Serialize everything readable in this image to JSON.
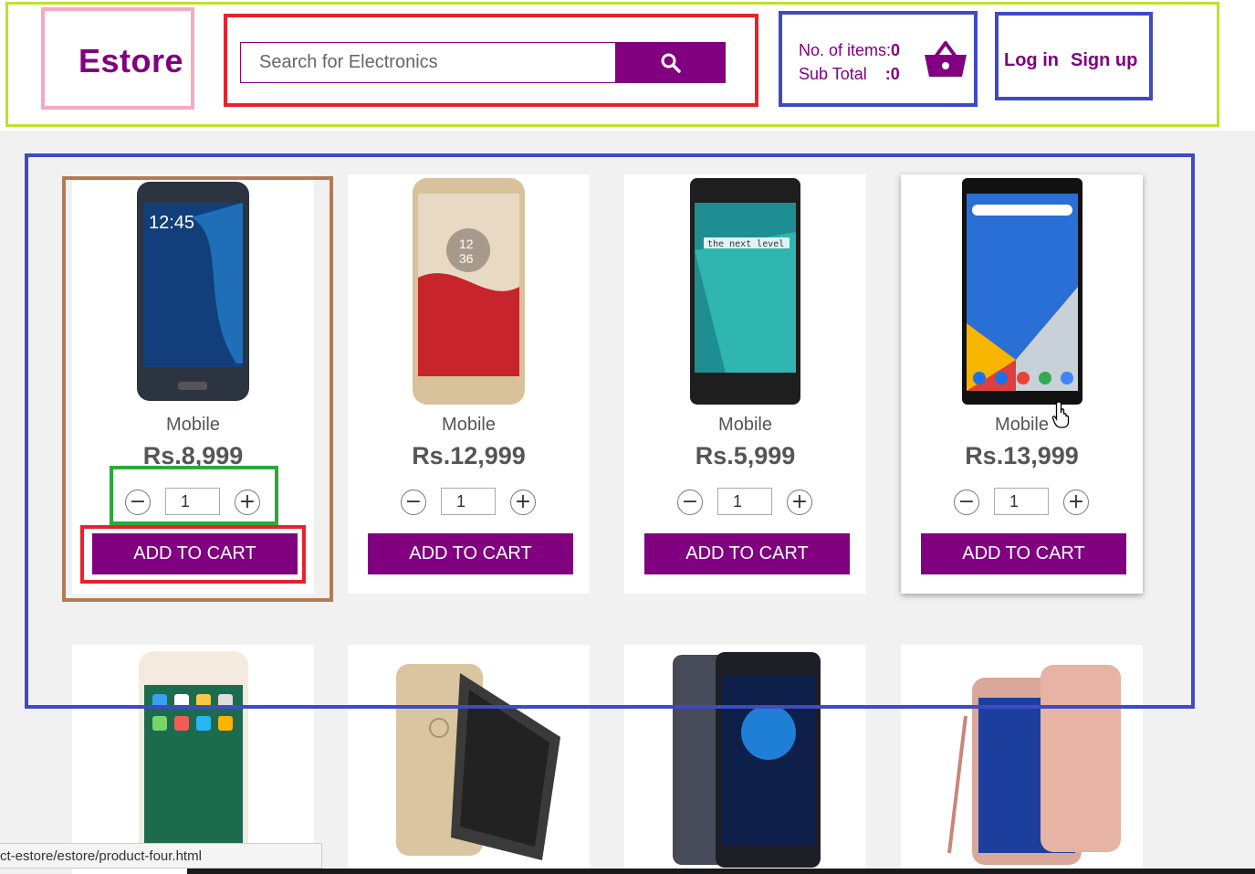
{
  "header": {
    "logo": "Estore",
    "search_placeholder": "Search for Electronics",
    "cart": {
      "items_label": "No. of items:",
      "items_value": "0",
      "subtotal_label": "Sub Total",
      "subtotal_value": ":0"
    },
    "login": "Log in",
    "signup": "Sign up"
  },
  "products": [
    {
      "category": "Mobile",
      "price": "Rs.8,999",
      "qty": "1",
      "button": "ADD TO CART",
      "phone_color": "#1c2a3a"
    },
    {
      "category": "Mobile",
      "price": "Rs.12,999",
      "qty": "1",
      "button": "ADD TO CART",
      "phone_color": "#d9c3a0"
    },
    {
      "category": "Mobile",
      "price": "Rs.5,999",
      "qty": "1",
      "button": "ADD TO CART",
      "phone_color": "#222222"
    },
    {
      "category": "Mobile",
      "price": "Rs.13,999",
      "qty": "1",
      "button": "ADD TO CART",
      "phone_color": "#111111"
    }
  ],
  "status_bar": "ct-estore/estore/product-four.html",
  "colors": {
    "brand": "#800080"
  }
}
